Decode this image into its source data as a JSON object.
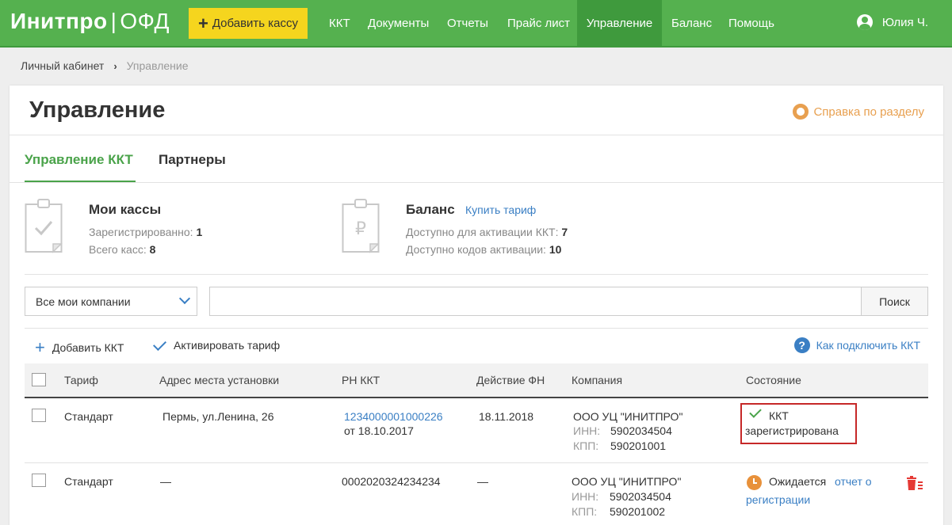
{
  "header": {
    "logo_brand": "Инитпро",
    "logo_separator": "|",
    "logo_product": "ОФД",
    "add_button": "Добавить кассу",
    "nav": [
      "ККТ",
      "Документы",
      "Отчеты",
      "Прайс лист",
      "Управление",
      "Баланс",
      "Помощь"
    ],
    "active_nav": "Управление",
    "user_name": "Юлия Ч."
  },
  "breadcrumb": {
    "home": "Личный кабинет",
    "arrow": "›",
    "current": "Управление"
  },
  "page": {
    "title": "Управление",
    "help_link": "Справка по разделу"
  },
  "tabs": [
    {
      "label": "Управление ККТ",
      "active": true
    },
    {
      "label": "Партнеры",
      "active": false
    }
  ],
  "summary": {
    "kassy": {
      "title": "Мои кассы",
      "registered_label": "Зарегистрированно:",
      "registered_value": "1",
      "total_label": "Всего касс:",
      "total_value": "8"
    },
    "balance": {
      "title": "Баланс",
      "buy_link": "Купить тариф",
      "available_label": "Доступно для активации ККТ:",
      "available_value": "7",
      "codes_label": "Доступно кодов активации:",
      "codes_value": "10",
      "currency_symbol": "₽"
    }
  },
  "filters": {
    "company_select": "Все мои компании",
    "search_value": "",
    "search_button": "Поиск"
  },
  "actions": {
    "add_kkt": "Добавить ККТ",
    "activate_tariff": "Активировать тариф",
    "how_to_connect": "Как подключить ККТ"
  },
  "table": {
    "columns": [
      "Тариф",
      "Адрес места установки",
      "РН ККТ",
      "Действие ФН",
      "Компания",
      "Состояние"
    ],
    "rows": [
      {
        "tariff": "Стандарт",
        "address": "Пермь, ул.Ленина, 26",
        "rn": "1234000001000226",
        "rn_date": "от 18.10.2017",
        "fn_action": "18.11.2018",
        "company": "ООО УЦ \"ИНИТПРО\"",
        "inn_label": "ИНН:",
        "inn": "5902034504",
        "kpp_label": "КПП:",
        "kpp": "590201001",
        "status_line1": "ККТ",
        "status_line2": "зарегистрирована"
      },
      {
        "tariff": "Стандарт",
        "address": "—",
        "rn": "0002020324234234",
        "fn_action": "—",
        "company": "ООО УЦ \"ИНИТПРО\"",
        "inn_label": "ИНН:",
        "inn": "5902034504",
        "kpp_label": "КПП:",
        "kpp": "590201002",
        "status_text": "Ожидается",
        "status_link1": "отчет о",
        "status_link2": "регистрации"
      }
    ]
  },
  "colors": {
    "header_green": "#55b14f",
    "active_nav_green": "#3f9a3d",
    "add_button_yellow": "#f5d51e",
    "link_blue": "#3a7fc4",
    "help_orange": "#e8a050",
    "status_highlight_red": "#c62828",
    "trash_red": "#e53935"
  }
}
